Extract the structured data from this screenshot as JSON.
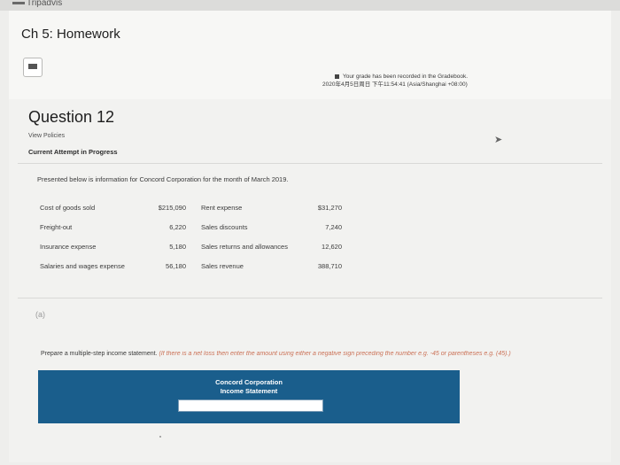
{
  "app": {
    "brand": "Tripadvis"
  },
  "assignment": {
    "title": "Ch 5: Homework"
  },
  "grade_note": {
    "line1": "Your grade has been recorded in the Gradebook.",
    "line2": "2020年4月5日周日 下午11:54:41 (Asia/Shanghai +08:00)"
  },
  "question": {
    "title": "Question 12",
    "view_policies": "View Policies",
    "attempt_status": "Current Attempt in Progress"
  },
  "problem": {
    "intro": "Presented below is information for Concord Corporation for the month of March 2019.",
    "rows": [
      {
        "left_label": "Cost of goods sold",
        "left_value": "$215,090",
        "right_label": "Rent expense",
        "right_value": "$31,270"
      },
      {
        "left_label": "Freight-out",
        "left_value": "6,220",
        "right_label": "Sales discounts",
        "right_value": "7,240"
      },
      {
        "left_label": "Insurance expense",
        "left_value": "5,180",
        "right_label": "Sales returns and allowances",
        "right_value": "12,620"
      },
      {
        "left_label": "Salaries and wages expense",
        "left_value": "56,180",
        "right_label": "Sales revenue",
        "right_value": "388,710"
      }
    ]
  },
  "part": {
    "label": "(a)"
  },
  "instruction": {
    "main": "Prepare a multiple-step income statement.",
    "note": "(If there is a net loss then enter the amount using either a negative sign preceding the number e.g. -45 or parentheses e.g. (45).)"
  },
  "statement": {
    "company": "Concord Corporation",
    "name": "Income Statement",
    "period_select_value": ""
  },
  "colors": {
    "statement_header": "#1a5e8c",
    "note_text": "#c45a3a"
  }
}
